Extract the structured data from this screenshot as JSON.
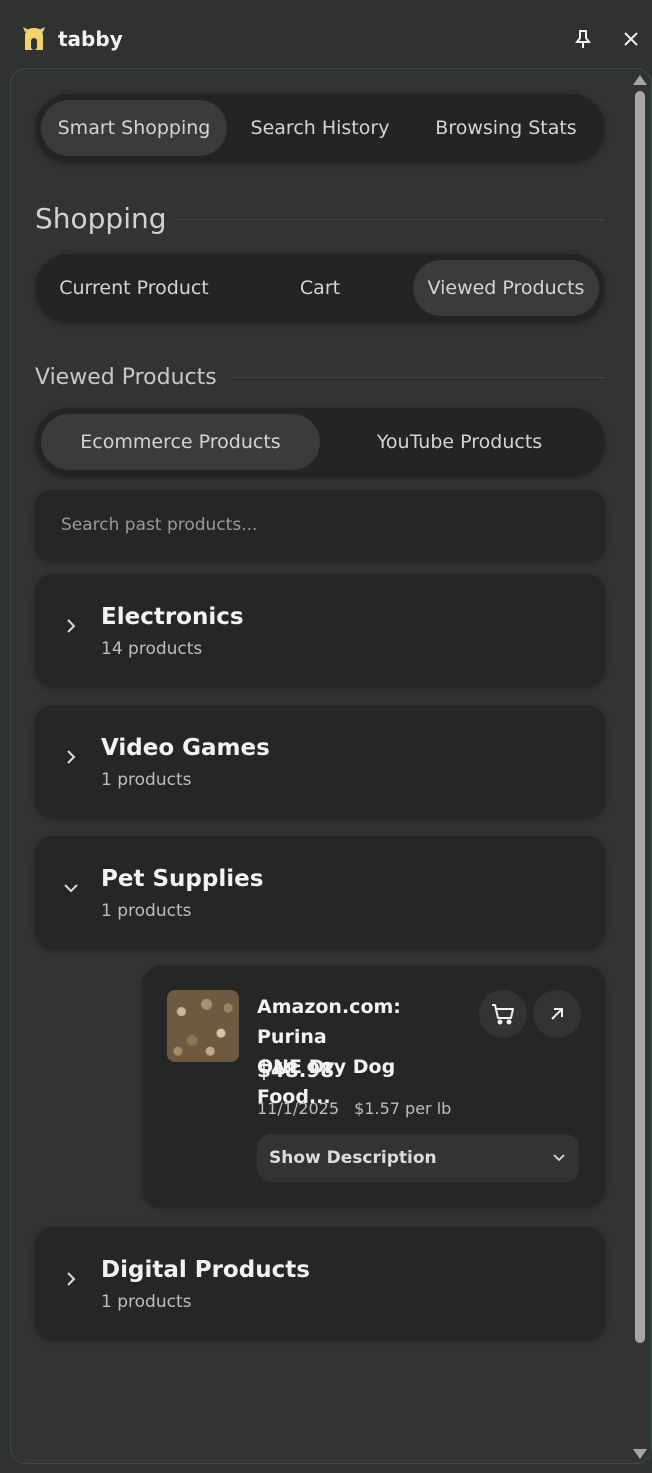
{
  "app": {
    "name": "tabby"
  },
  "main_tabs": [
    {
      "label": "Smart Shopping",
      "active": true
    },
    {
      "label": "Search History",
      "active": false
    },
    {
      "label": "Browsing Stats",
      "active": false
    }
  ],
  "shopping": {
    "title": "Shopping",
    "tabs": [
      {
        "label": "Current Product",
        "active": false
      },
      {
        "label": "Cart",
        "active": false
      },
      {
        "label": "Viewed Products",
        "active": true
      }
    ]
  },
  "viewed": {
    "title": "Viewed Products",
    "tabs": [
      {
        "label": "Ecommerce Products",
        "active": true
      },
      {
        "label": "YouTube Products",
        "active": false
      }
    ],
    "search_placeholder": "Search past products...",
    "categories": [
      {
        "name": "Electronics",
        "count": "14 products",
        "expanded": false
      },
      {
        "name": "Video Games",
        "count": "1 products",
        "expanded": false
      },
      {
        "name": "Pet Supplies",
        "count": "1 products",
        "expanded": true
      },
      {
        "name": "Digital Products",
        "count": "1 products",
        "expanded": false
      }
    ],
    "product": {
      "title_line1": "Amazon.com: Purina",
      "title_line2": "ONE Dry Dog Food...",
      "price": "$48.98",
      "date": "11/1/2025",
      "unit_price": "$1.57 per lb",
      "description_button": "Show Description"
    }
  },
  "icons": [
    "app-logo-icon",
    "pin-icon",
    "close-icon",
    "chevron-right-icon",
    "chevron-down-icon",
    "cart-icon",
    "external-link-icon"
  ]
}
